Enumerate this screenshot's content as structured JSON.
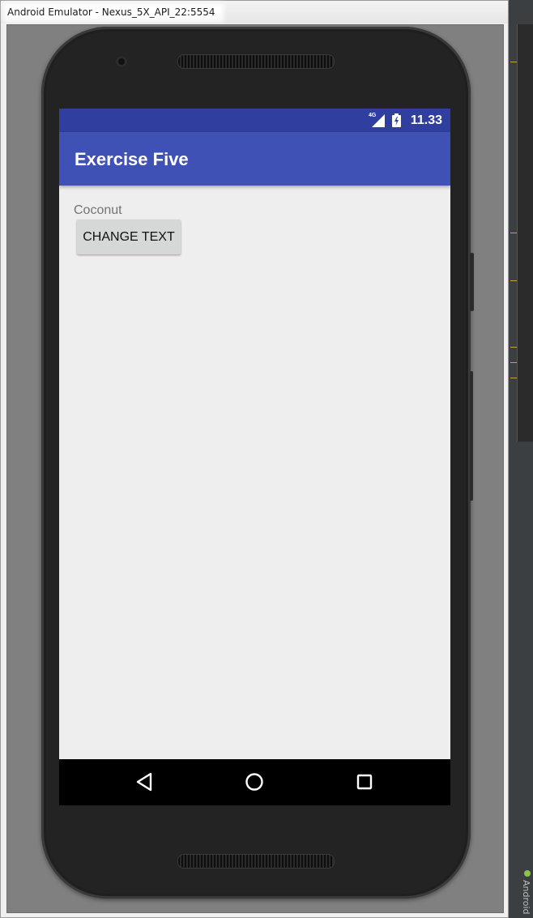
{
  "window": {
    "title": "Android Emulator - Nexus_5X_API_22:5554"
  },
  "status_bar": {
    "network": "4G",
    "time": "11.33",
    "color": "#303f9f"
  },
  "app_bar": {
    "title": "Exercise Five",
    "color": "#3f51b5"
  },
  "content": {
    "text": "Coconut",
    "button_label": "CHANGE TEXT"
  },
  "nav_bar": {
    "back_icon": "back-triangle-icon",
    "home_icon": "home-circle-icon",
    "recents_icon": "recents-square-icon"
  },
  "ide": {
    "side_label": "Android"
  }
}
